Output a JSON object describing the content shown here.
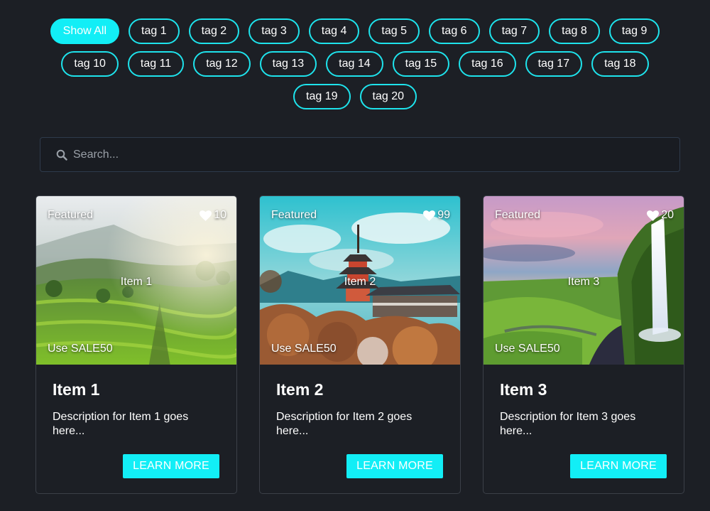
{
  "filters": {
    "tags": [
      "Show All",
      "tag 1",
      "tag 2",
      "tag 3",
      "tag 4",
      "tag 5",
      "tag 6",
      "tag 7",
      "tag 8",
      "tag 9",
      "tag 10",
      "tag 11",
      "tag 12",
      "tag 13",
      "tag 14",
      "tag 15",
      "tag 16",
      "tag 17",
      "tag 18",
      "tag 19",
      "tag 20"
    ],
    "active": "Show All"
  },
  "search": {
    "placeholder": "Search...",
    "value": ""
  },
  "cards": [
    {
      "badge": "Featured",
      "likes": "10",
      "image_label": "Item 1",
      "promo": "Use SALE50",
      "title": "Item 1",
      "description": "Description for Item 1 goes here...",
      "button": "LEARN MORE",
      "image": "rice-terraces"
    },
    {
      "badge": "Featured",
      "likes": "99",
      "image_label": "Item 2",
      "promo": "Use SALE50",
      "title": "Item 2",
      "description": "Description for Item 2 goes here...",
      "button": "LEARN MORE",
      "image": "japanese-pagoda"
    },
    {
      "badge": "Featured",
      "likes": "20",
      "image_label": "Item 3",
      "promo": "Use SALE50",
      "title": "Item 3",
      "description": "Description for Item 3 goes here...",
      "button": "LEARN MORE",
      "image": "waterfall"
    }
  ],
  "colors": {
    "accent": "#12eef6",
    "background": "#1c1f25",
    "border": "#3c4048"
  },
  "icons": {
    "search": "search-icon",
    "like": "heart-icon"
  }
}
